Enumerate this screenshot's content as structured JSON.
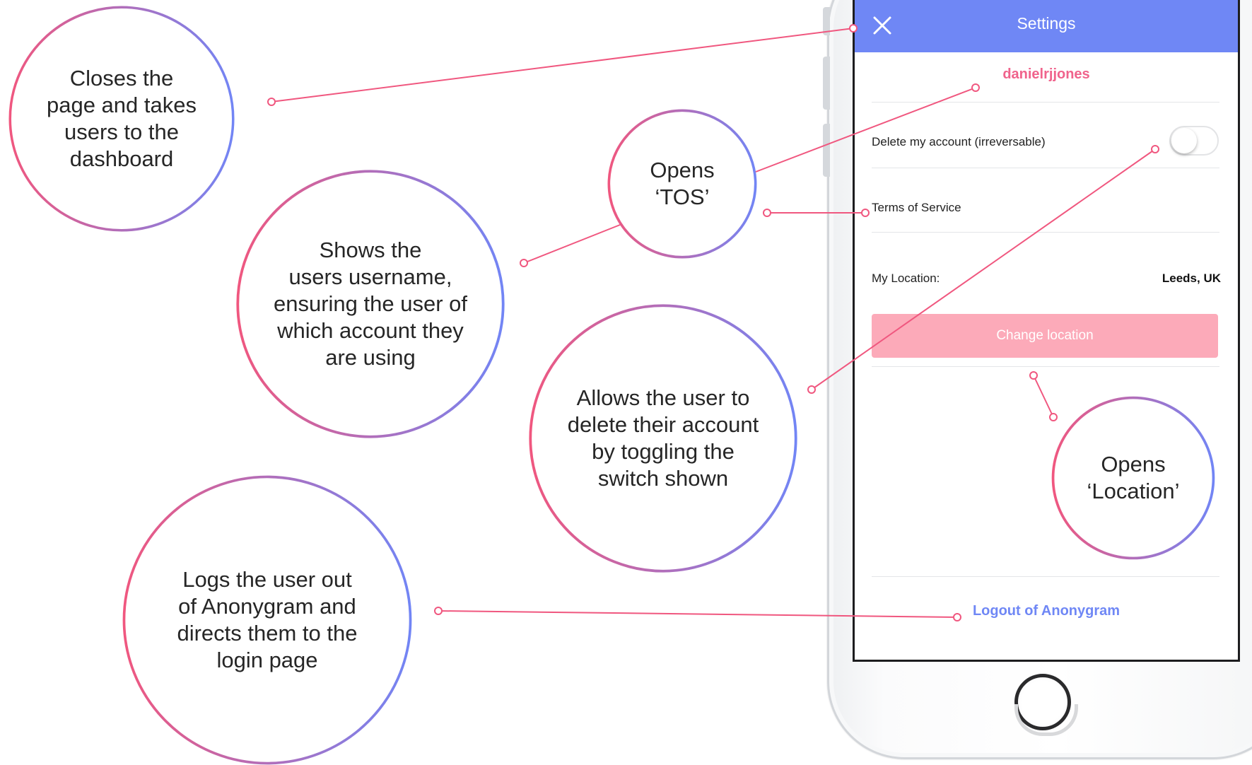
{
  "app": {
    "nav": {
      "title": "Settings",
      "close_icon": "close-icon"
    },
    "username": "danielrjjones",
    "rows": {
      "delete_account_label": "Delete my account (irreversable)",
      "delete_account_enabled": false,
      "tos_label": "Terms of Service",
      "location_label": "My Location:",
      "location_value": "Leeds, UK"
    },
    "change_location_button": "Change location",
    "logout_link": "Logout of Anonygram"
  },
  "annotations": {
    "close": "Closes the\npage and takes\nusers to the\ndashboard",
    "username": "Shows the\nusers username,\nensuring the user of\nwhich account they\nare using",
    "tos": "Opens\n‘TOS’",
    "delete": "Allows the user to\ndelete their account\nby toggling the\nswitch shown",
    "location": "Opens\n‘Location’",
    "logout": "Logs the user out\nof Anonygram and\ndirects them to the\nlogin page"
  },
  "colors": {
    "nav_blue": "#6f87f5",
    "username_pink": "#f0638c",
    "button_pink": "#fcaab9",
    "connector_pink": "#f0577f",
    "ring_gradient_start": "#f0577f",
    "ring_gradient_end": "#7285f5"
  }
}
